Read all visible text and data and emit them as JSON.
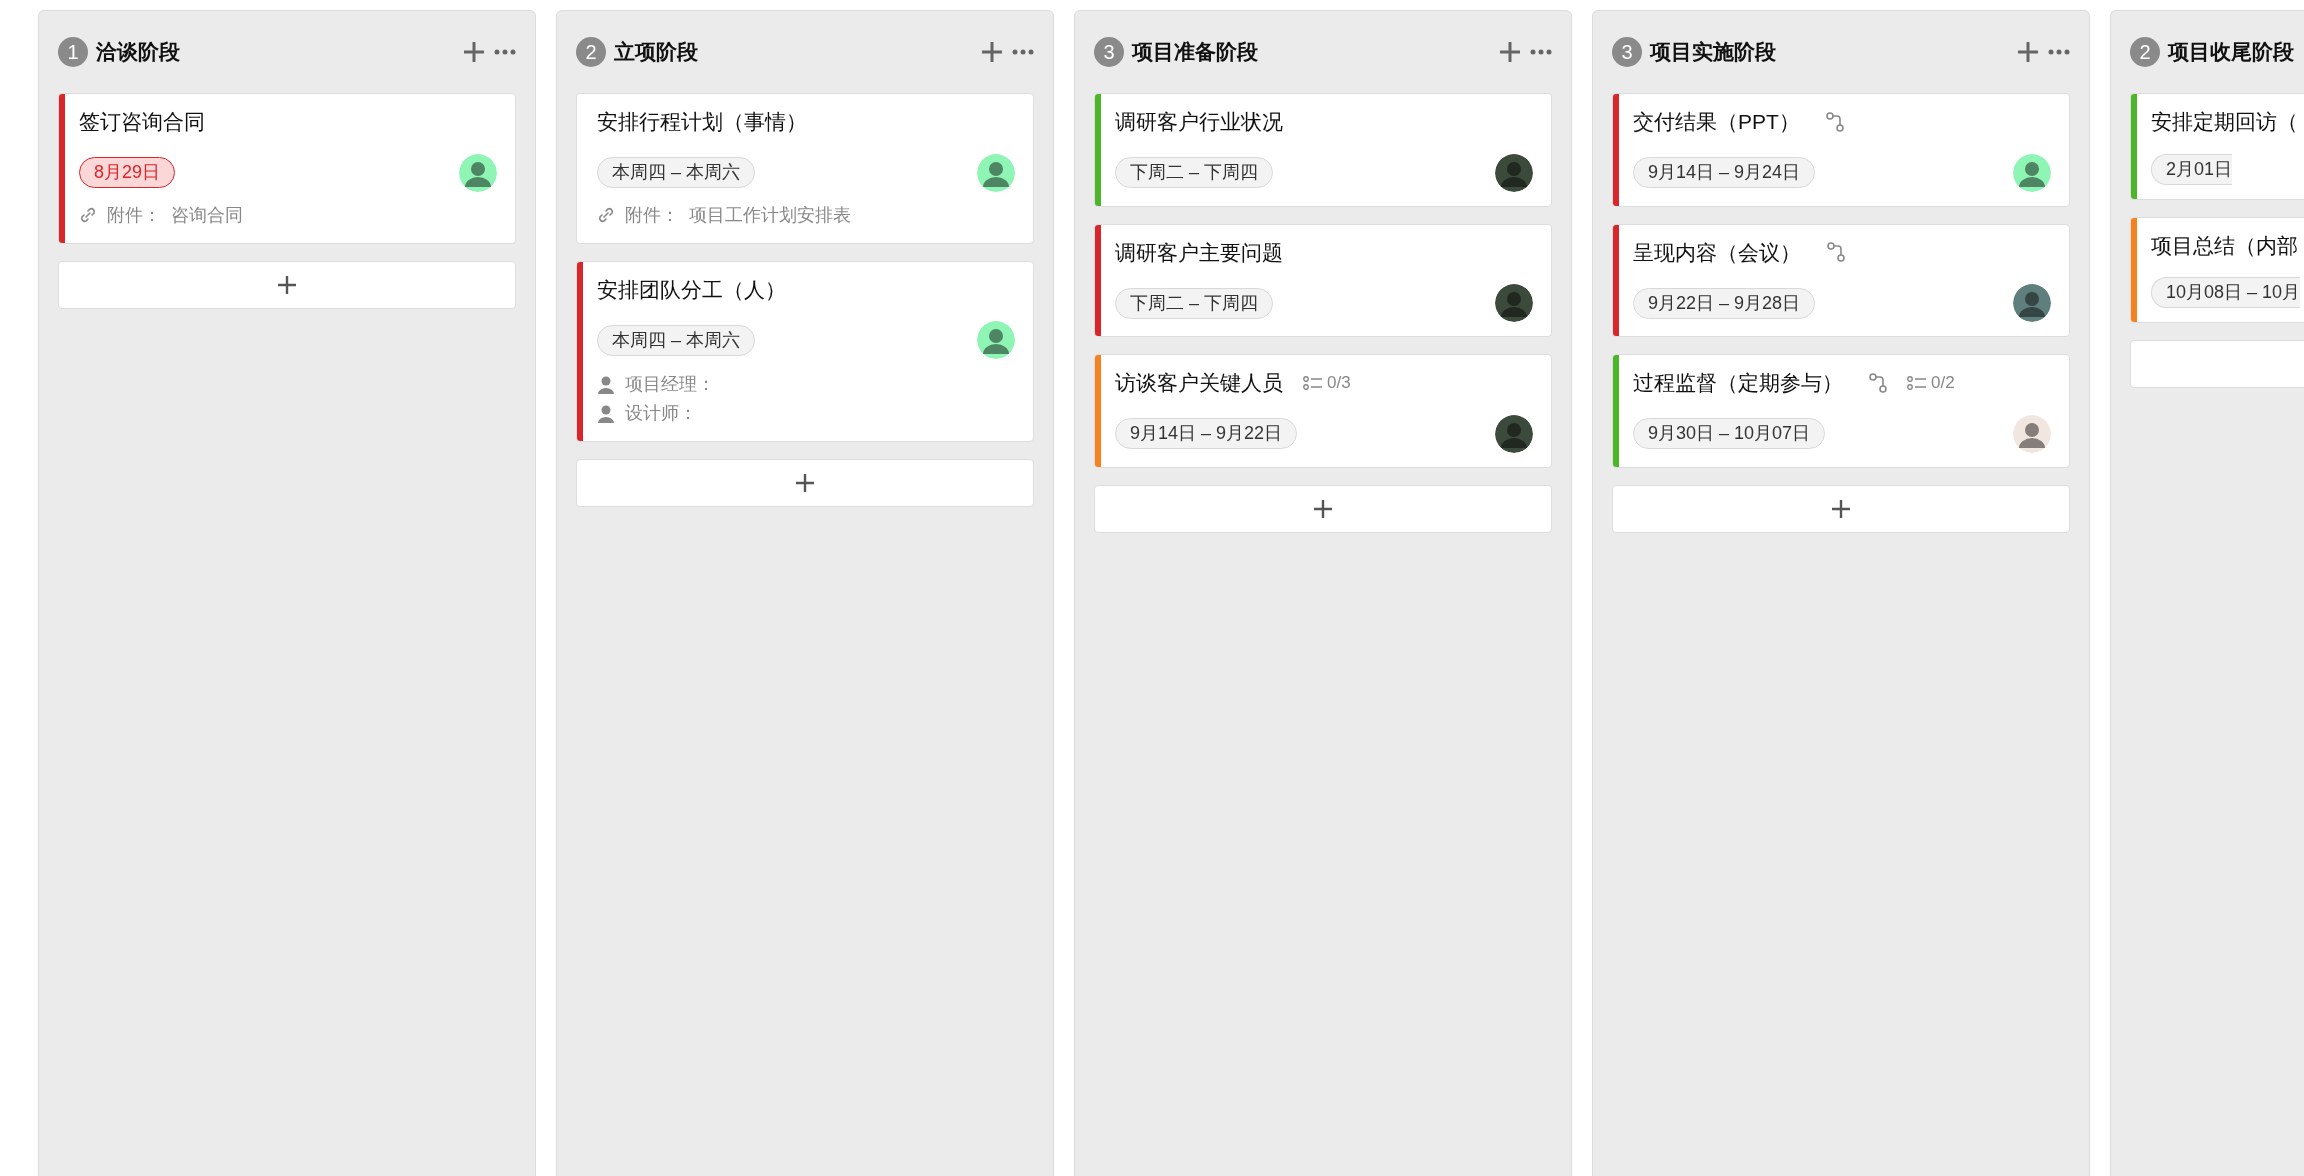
{
  "columns": [
    {
      "count": "1",
      "title": "洽谈阶段",
      "cut": false,
      "cards": [
        {
          "title": "签订咨询合同",
          "color": "#d9262b",
          "branch": false,
          "date": {
            "text": "8月29日",
            "overdue": true
          },
          "avatar": {
            "color": "#8ef5b5"
          },
          "attachment": {
            "label": "附件：",
            "value": "咨询合同"
          }
        }
      ]
    },
    {
      "count": "2",
      "title": "立项阶段",
      "cut": false,
      "cards": [
        {
          "title": "安排行程计划（事情）",
          "branch": false,
          "date": {
            "text": "本周四 – 本周六",
            "overdue": false
          },
          "avatar": {
            "color": "#8ef5b5"
          },
          "attachment": {
            "label": "附件：",
            "value": "项目工作计划安排表"
          }
        },
        {
          "title": "安排团队分工（人）",
          "color": "#d9262b",
          "branch": false,
          "date": {
            "text": "本周四 – 本周六",
            "overdue": false
          },
          "avatar": {
            "color": "#8ef5b5"
          },
          "people": [
            "项目经理：",
            "设计师："
          ]
        }
      ]
    },
    {
      "count": "3",
      "title": "项目准备阶段",
      "cut": false,
      "cards": [
        {
          "title": "调研客户行业状况",
          "color": "#4cb52a",
          "branch": false,
          "date": {
            "text": "下周二 – 下周四",
            "overdue": false
          },
          "avatar": {
            "color": "#3b4a3a"
          }
        },
        {
          "title": "调研客户主要问题",
          "color": "#d9262b",
          "branch": false,
          "date": {
            "text": "下周二 – 下周四",
            "overdue": false
          },
          "avatar": {
            "color": "#3b4a3a"
          }
        },
        {
          "title": "访谈客户关键人员",
          "color": "#f5821f",
          "branch": false,
          "checklist": "0/3",
          "date": {
            "text": "9月14日 – 9月22日",
            "overdue": false
          },
          "avatar": {
            "color": "#3b4a3a"
          }
        }
      ]
    },
    {
      "count": "3",
      "title": "项目实施阶段",
      "cut": false,
      "cards": [
        {
          "title": "交付结果（PPT）",
          "color": "#d9262b",
          "branch": true,
          "date": {
            "text": "9月14日 – 9月24日",
            "overdue": false
          },
          "avatar": {
            "color": "#8ef5b5"
          }
        },
        {
          "title": "呈现内容（会议）",
          "color": "#d9262b",
          "branch": true,
          "date": {
            "text": "9月22日 – 9月28日",
            "overdue": false
          },
          "avatar": {
            "color": "#5f7f7c"
          }
        },
        {
          "title": "过程监督（定期参与）",
          "color": "#4cb52a",
          "branch": true,
          "checklist": "0/2",
          "date": {
            "text": "9月30日 – 10月07日",
            "overdue": false
          },
          "avatar": {
            "color": "#f2e6e0"
          }
        }
      ]
    },
    {
      "count": "2",
      "title": "项目收尾阶段",
      "cut": true,
      "cards": [
        {
          "title": "安排定期回访（",
          "color": "#4cb52a",
          "branch": false,
          "date": {
            "text": "2月01日",
            "overdue": false
          }
        },
        {
          "title": "项目总结（内部",
          "color": "#f5821f",
          "branch": false,
          "date": {
            "text": "10月08日 – 10月",
            "overdue": false
          }
        }
      ]
    }
  ]
}
